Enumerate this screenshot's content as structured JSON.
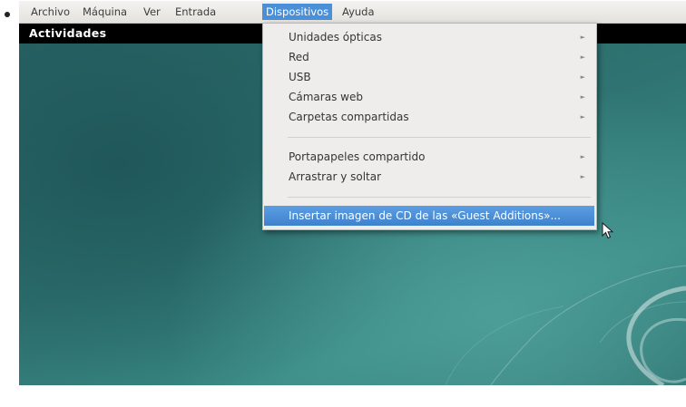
{
  "menubar": {
    "items": [
      "Archivo",
      "Máquina",
      "Ver",
      "Entrada",
      "Dispositivos",
      "Ayuda"
    ],
    "active": "Dispositivos"
  },
  "guest": {
    "activities_label": "Actividades"
  },
  "dropdown": {
    "items": [
      {
        "label": "Unidades ópticas",
        "submenu": true
      },
      {
        "label": "Red",
        "submenu": true
      },
      {
        "label": "USB",
        "submenu": true
      },
      {
        "label": "Cámaras web",
        "submenu": true
      },
      {
        "label": "Carpetas compartidas",
        "submenu": true
      },
      {
        "label": "Portapapeles compartido",
        "submenu": true
      },
      {
        "label": "Arrastrar y soltar",
        "submenu": true
      },
      {
        "label": "Insertar imagen de CD de las «Guest Additions»...",
        "submenu": false,
        "highlighted": true
      }
    ],
    "arrow_glyph": "►"
  },
  "colors": {
    "accent": "#4a90d9",
    "desktop": "#2f7472",
    "topbar": "#000000"
  },
  "icons": {
    "bullet": "bullet-dot",
    "submenu": "triangle-right-icon",
    "pointer": "mouse-pointer-icon",
    "wallpaper": "debian-swirl-icon"
  }
}
